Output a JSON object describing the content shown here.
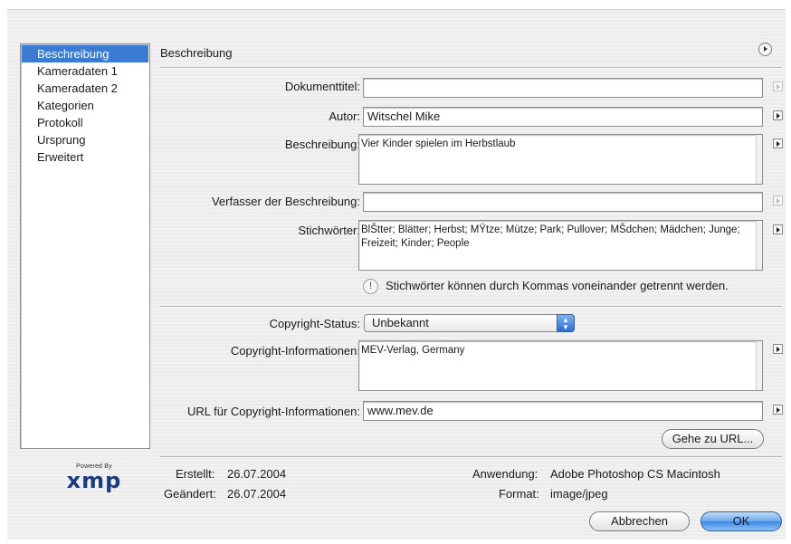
{
  "sidebar": {
    "items": [
      {
        "label": "Beschreibung",
        "selected": true
      },
      {
        "label": "Kameradaten 1",
        "selected": false
      },
      {
        "label": "Kameradaten 2",
        "selected": false
      },
      {
        "label": "Kategorien",
        "selected": false
      },
      {
        "label": "Protokoll",
        "selected": false
      },
      {
        "label": "Ursprung",
        "selected": false
      },
      {
        "label": "Erweitert",
        "selected": false
      }
    ],
    "logo": {
      "powered": "Powered By",
      "word": "xmp"
    }
  },
  "section": {
    "title": "Beschreibung",
    "menu_icon": "circle-arrow-icon"
  },
  "fields": {
    "dokumenttitel": {
      "label": "Dokumenttitel:",
      "value": ""
    },
    "autor": {
      "label": "Autor:",
      "value": "Witschel Mike"
    },
    "beschreibung": {
      "label": "Beschreibung:",
      "value": "Vier Kinder spielen im Herbstlaub"
    },
    "verfasser": {
      "label": "Verfasser der Beschreibung:",
      "value": ""
    },
    "stichwoerter": {
      "label": "Stichwörter:",
      "value": "BlŠtter; Blätter; Herbst; MŸtze; Mütze; Park; Pullover; MŠdchen; Mädchen; Junge; Freizeit; Kinder; People"
    },
    "hint": "Stichwörter können durch Kommas voneinander getrennt werden.",
    "copyright_status": {
      "label": "Copyright-Status:",
      "value": "Unbekannt"
    },
    "copyright_info": {
      "label": "Copyright-Informationen:",
      "value": "MEV-Verlag, Germany"
    },
    "copyright_url": {
      "label": "URL für Copyright-Informationen:",
      "value": "www.mev.de"
    }
  },
  "buttons": {
    "goto_url": "Gehe zu URL...",
    "cancel": "Abbrechen",
    "ok": "OK"
  },
  "meta": {
    "erstellt_label": "Erstellt:",
    "erstellt": "26.07.2004",
    "geaendert_label": "Geändert:",
    "geaendert": "26.07.2004",
    "anwendung_label": "Anwendung:",
    "anwendung": "Adobe Photoshop CS Macintosh",
    "format_label": "Format:",
    "format": "image/jpeg"
  },
  "colors": {
    "selection": "#3b7bd4",
    "ok_button": "#3d86e0",
    "logo": "#1d3b79"
  }
}
